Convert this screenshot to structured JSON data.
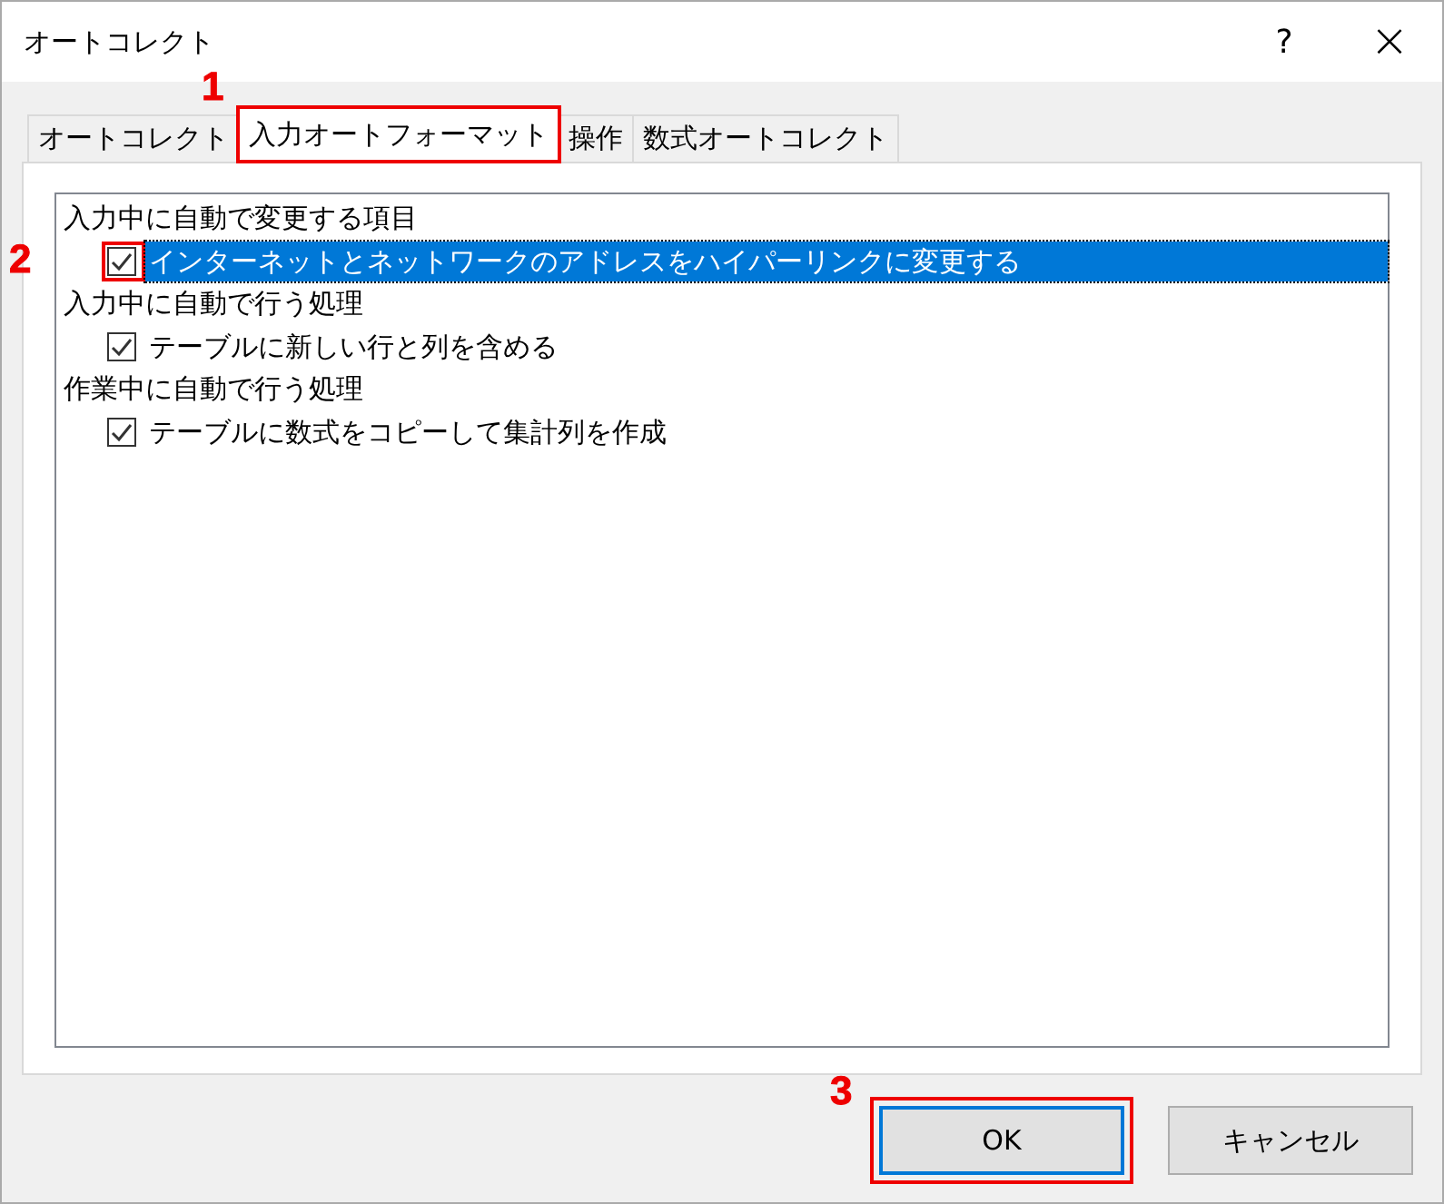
{
  "window": {
    "title": "オートコレクト",
    "help": "?",
    "close": "×"
  },
  "tabs": [
    {
      "label": "オートコレクト",
      "selected": false,
      "highlighted": false
    },
    {
      "label": "入力オートフォーマット",
      "selected": true,
      "highlighted": true,
      "step": "1"
    },
    {
      "label": "操作",
      "selected": false,
      "highlighted": false
    },
    {
      "label": "数式オートコレクト",
      "selected": false,
      "highlighted": false
    }
  ],
  "options": [
    {
      "label": "入力中に自動で変更する項目",
      "children": [
        {
          "label": "インターネットとネットワークのアドレスをハイパーリンクに変更する",
          "checked": true,
          "selected": true,
          "highlighted": true,
          "step": "2"
        }
      ]
    },
    {
      "label": "入力中に自動で行う処理",
      "children": [
        {
          "label": "テーブルに新しい行と列を含める",
          "checked": true,
          "selected": false,
          "highlighted": false
        }
      ]
    },
    {
      "label": "作業中に自動で行う処理",
      "children": [
        {
          "label": "テーブルに数式をコピーして集計列を作成",
          "checked": true,
          "selected": false,
          "highlighted": false
        }
      ]
    }
  ],
  "buttons": [
    {
      "label": "OK",
      "default": true,
      "highlighted": true,
      "step": "3"
    },
    {
      "label": "キャンセル",
      "default": false,
      "highlighted": false
    }
  ]
}
